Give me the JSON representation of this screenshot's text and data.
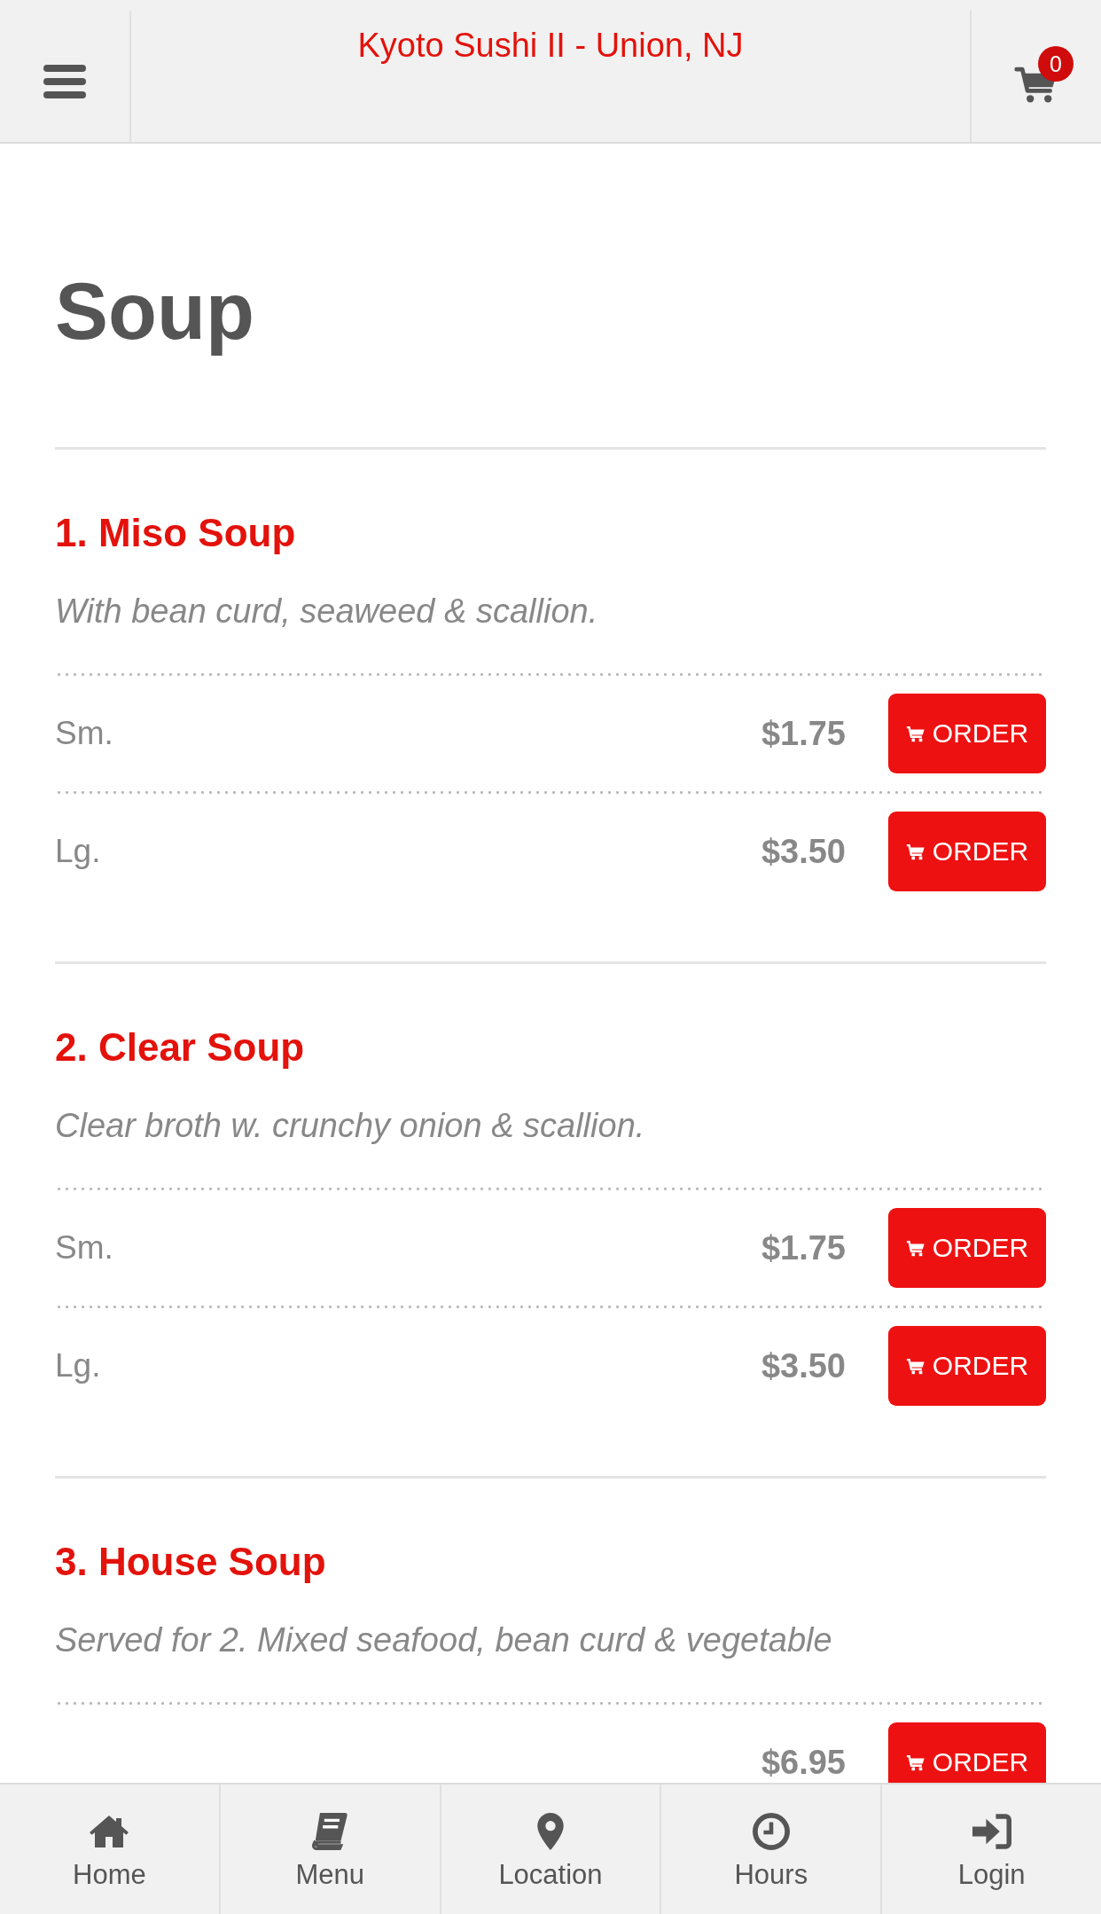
{
  "header": {
    "title": "Kyoto Sushi II - Union, NJ",
    "cart_count": "0"
  },
  "section_title": "Soup",
  "items": [
    {
      "name": "1. Miso Soup",
      "description": "With bean curd, seaweed & scallion.",
      "options": [
        {
          "label": "Sm.",
          "price": "$1.75",
          "button": "ORDER"
        },
        {
          "label": "Lg.",
          "price": "$3.50",
          "button": "ORDER"
        }
      ]
    },
    {
      "name": "2. Clear Soup",
      "description": "Clear broth w. crunchy onion & scallion.",
      "options": [
        {
          "label": "Sm.",
          "price": "$1.75",
          "button": "ORDER"
        },
        {
          "label": "Lg.",
          "price": "$3.50",
          "button": "ORDER"
        }
      ]
    },
    {
      "name": "3. House Soup",
      "description": "Served for 2. Mixed seafood, bean curd & vegetable",
      "options": [
        {
          "price": "$6.95",
          "button": "ORDER"
        }
      ]
    }
  ],
  "nav": [
    {
      "kind": "home",
      "label": "Home"
    },
    {
      "kind": "menu",
      "label": "Menu"
    },
    {
      "kind": "location",
      "label": "Location"
    },
    {
      "kind": "hours",
      "label": "Hours"
    },
    {
      "kind": "login",
      "label": "Login"
    }
  ]
}
